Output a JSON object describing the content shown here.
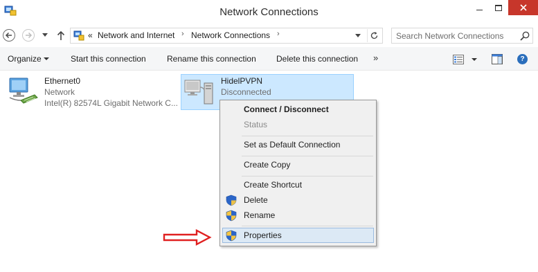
{
  "window": {
    "title": "Network Connections"
  },
  "address": {
    "overflow": "«",
    "crumbs": [
      "Network and Internet",
      "Network Connections"
    ],
    "separator": "›"
  },
  "search": {
    "placeholder": "Search Network Connections"
  },
  "toolbar": {
    "organize": "Organize",
    "start": "Start this connection",
    "rename": "Rename this connection",
    "delete": "Delete this connection",
    "more": "»"
  },
  "items": [
    {
      "name": "Ethernet0",
      "type": "Network",
      "device": "Intel(R) 82574L Gigabit Network C..."
    },
    {
      "name": "HidelPVPN",
      "status": "Disconnected"
    }
  ],
  "context_menu": {
    "items": [
      {
        "label": "Connect / Disconnect",
        "bold": true
      },
      {
        "label": "Status",
        "disabled": true
      },
      {
        "label": "Set as Default Connection"
      },
      {
        "label": "Create Copy"
      },
      {
        "label": "Create Shortcut"
      },
      {
        "label": "Delete",
        "icon": "shield-icon"
      },
      {
        "label": "Rename",
        "icon": "shield-icon"
      },
      {
        "label": "Properties",
        "icon": "shield-icon",
        "highlighted": true
      }
    ]
  },
  "colors": {
    "selection": "#cce8ff",
    "close_button": "#c7362b",
    "annotation_arrow": "#e02020"
  }
}
